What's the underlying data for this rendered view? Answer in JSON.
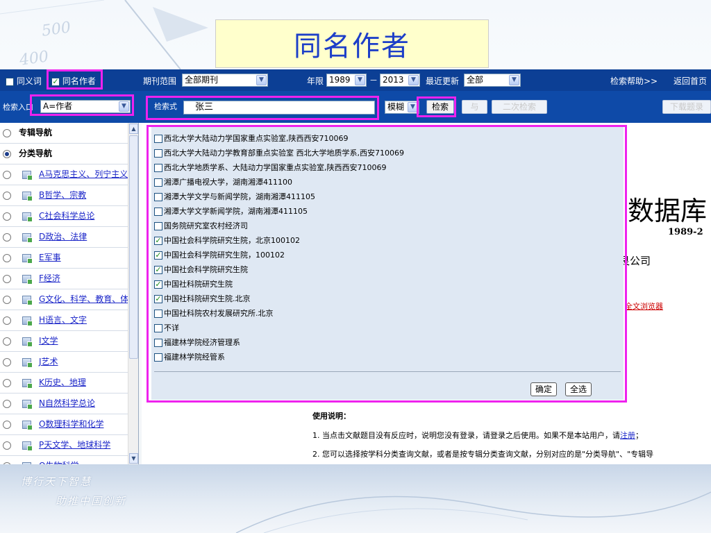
{
  "slide_title": "同名作者",
  "deco_numbers": [
    "500",
    "400"
  ],
  "toolbar1": {
    "synonym_label": "同义词",
    "same_author_label": "同名作者",
    "journal_scope_label": "期刊范围",
    "journal_scope_value": "全部期刊",
    "year_label": "年限",
    "year_from": "1989",
    "year_dash": "－",
    "year_to": "2013",
    "recent_update_label": "最近更新",
    "recent_update_value": "全部",
    "help_link": "检索帮助>>",
    "home_link": "返回首页"
  },
  "toolbar2": {
    "search_entry_label": "检索入口",
    "search_entry_value": "A=作者",
    "query_label": "检索式",
    "query_value": "张三",
    "match_value": "模糊",
    "search_button": "检索",
    "and_button": "与",
    "secondary_search_button": "二次检索",
    "download_button": "下载题录"
  },
  "sidebar": {
    "special_nav": "专辑导航",
    "category_nav": "分类导航",
    "categories": [
      "A马克思主义、列宁主义",
      "B哲学、宗教",
      "C社会科学总论",
      "D政治、法律",
      "E军事",
      "F经济",
      "G文化、科学、教育、体育",
      "H语言、文字",
      "I文学",
      "J艺术",
      "K历史、地理",
      "N自然科学总论",
      "O数理科学和化学",
      "P天文学、地球科学",
      "Q生物科学"
    ]
  },
  "popup": {
    "items": [
      {
        "label": "西北大学大陆动力学国家重点实验室,陕西西安710069",
        "checked": false
      },
      {
        "label": "西北大学大陆动力学教育部重点实验室 西北大学地质学系,西安710069",
        "checked": false
      },
      {
        "label": "西北大学地质学系、大陆动力学国家重点实验室,陕西西安710069",
        "checked": false
      },
      {
        "label": "湘潭广播电视大学，湖南湘潭411100",
        "checked": false
      },
      {
        "label": "湘潭大学文学与新闻学院，湖南湘潭411105",
        "checked": false
      },
      {
        "label": "湘潭大学文学新闻学院，湖南湘潭411105",
        "checked": false
      },
      {
        "label": "国务院研究室农村经济司",
        "checked": false
      },
      {
        "label": "中国社会科学院研究生院，北京100102",
        "checked": true
      },
      {
        "label": "中国社会科学院研究生院，100102",
        "checked": true
      },
      {
        "label": "中国社会科学院研究生院",
        "checked": true
      },
      {
        "label": "中国社科院研究生院",
        "checked": true
      },
      {
        "label": "中国社科院研究生院.北京",
        "checked": true
      },
      {
        "label": "中国社科院农村发展研究所.北京",
        "checked": false
      },
      {
        "label": "不详",
        "checked": false
      },
      {
        "label": "福建林学院经济管理系",
        "checked": false
      },
      {
        "label": "福建林学院经管系",
        "checked": false
      }
    ],
    "ok_button": "确定",
    "select_all_button": "全选"
  },
  "right_content": {
    "database_title": "数据库",
    "years": "1989-2",
    "company": "艮公司",
    "browser_link": "全文浏览器"
  },
  "usage": {
    "heading": "使用说明：",
    "line1_prefix": "1. 当点击文献题目没有反应时，说明您没有登录，请登录之后使用。如果不是本站用户，请",
    "line1_link": "注册",
    "line1_suffix": "；",
    "line2": "2. 您可以选择按学科分类查询文献，或者是按专辑分类查询文献，分别对应的是\"分类导航\"、\"专辑导"
  },
  "footer": {
    "slogan1": "博行天下智慧",
    "slogan2": "助推中国创新"
  },
  "colors": {
    "toolbar_dark": "#0c3f95",
    "toolbar": "#0e4aa8",
    "highlight": "#ee22ee",
    "title_text": "#1c3ec8",
    "title_bg": "#ffffcc",
    "link": "#1a25c8"
  }
}
